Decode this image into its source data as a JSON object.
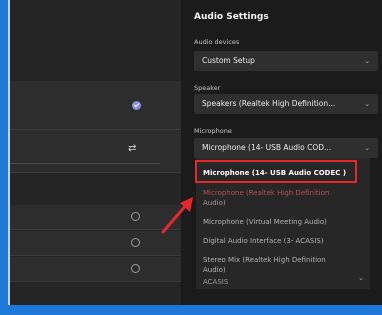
{
  "audio_settings": {
    "title": "Audio Settings",
    "audio_devices": {
      "label": "Audio devices",
      "value": "Custom Setup"
    },
    "speaker": {
      "label": "Speaker",
      "value": "Speakers (Realtek High Definition..."
    },
    "microphone": {
      "label": "Microphone",
      "value": "Microphone (14- USB Audio COD..."
    },
    "options": [
      "Microphone (14- USB Audio CODEC )",
      "Microphone (Realtek High Definition",
      "Audio)",
      "Microphone (Virtual Meeting Audio)",
      "Digital Audio Interface (3- ACASIS)",
      "Stereo Mix (Realtek High Definition",
      "Audio)",
      "ACASIS"
    ]
  },
  "colors": {
    "highlight_box": "#e6282c",
    "accent": "#8b8ddc",
    "frame_blue": "#1e78d7"
  },
  "icons": {
    "selected": "check-circle-icon",
    "radio": "radio-icon",
    "settings": "sliders-icon",
    "chevron": "chevron-down-icon",
    "pointer": "arrow-icon"
  }
}
